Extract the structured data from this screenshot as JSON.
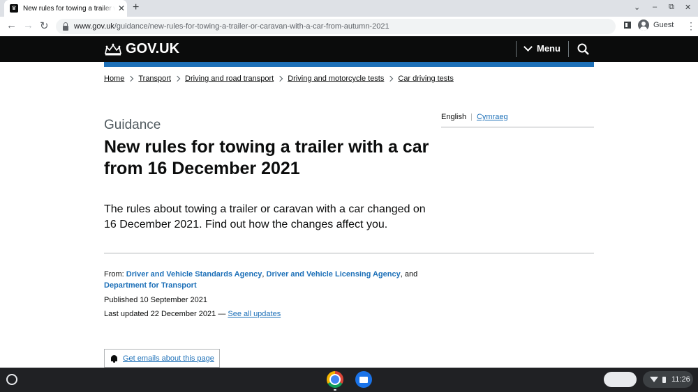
{
  "browser": {
    "tab_title": "New rules for towing a trailer with a car from 16 December 2021 - GOV.UK",
    "new_tab_label": "+",
    "url_host": "www.gov.uk",
    "url_path": "/guidance/new-rules-for-towing-a-trailer-or-caravan-with-a-car-from-autumn-2021",
    "profile_label": "Guest"
  },
  "header": {
    "logo_text": "GOV.UK",
    "menu_label": "Menu"
  },
  "breadcrumbs": [
    "Home",
    "Transport",
    "Driving and road transport",
    "Driving and motorcycle tests",
    "Car driving tests"
  ],
  "language": {
    "current": "English",
    "alternate": "Cymraeg"
  },
  "page": {
    "caption": "Guidance",
    "title": "New rules for towing a trailer with a car from 16 December 2021",
    "lede": "The rules about towing a trailer or caravan with a car changed on 16 December 2021. Find out how the changes affect you."
  },
  "metadata": {
    "from_label": "From:",
    "orgs": [
      "Driver and Vehicle Standards Agency",
      "Driver and Vehicle Licensing Agency",
      "Department for Transport"
    ],
    "org_sep_1": ",",
    "org_sep_2": ", and",
    "published_label": "Published 10 September 2021",
    "updated_label": "Last updated",
    "updated_value": "22 December 2021",
    "updated_dash": "—",
    "see_all_updates": "See all updates"
  },
  "actions": {
    "get_emails": "Get emails about this page"
  },
  "shelf": {
    "time": "11:26"
  },
  "colors": {
    "govuk_black": "#0b0c0c",
    "govuk_blue": "#1d70b8",
    "secondary_text": "#505a5f",
    "border": "#b1b4b6"
  }
}
